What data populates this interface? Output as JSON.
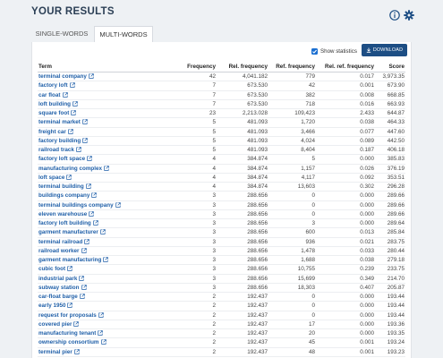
{
  "header": {
    "title": "YOUR RESULTS",
    "info_icon": "info-icon",
    "settings_icon": "gear-icon"
  },
  "tabs": [
    {
      "label": "SINGLE-WORDS",
      "active": false
    },
    {
      "label": "MULTI-WORDS",
      "active": true
    }
  ],
  "toolbar": {
    "show_statistics_label": "Show statistics",
    "show_statistics_checked": true,
    "download_label": "DOWNLOAD"
  },
  "colors": {
    "accent": "#1d4e84",
    "link": "#1f5fa8",
    "title": "#2b3f55"
  },
  "table": {
    "columns": [
      "Term",
      "Frequency",
      "Rel. frequency",
      "Ref. frequency",
      "Rel. ref. frequency",
      "Score"
    ],
    "rows": [
      [
        "terminal company",
        "42",
        "4,041.182",
        "779",
        "0.017",
        "3,973.35"
      ],
      [
        "factory loft",
        "7",
        "673.530",
        "42",
        "0.001",
        "673.90"
      ],
      [
        "car float",
        "7",
        "673.530",
        "382",
        "0.008",
        "668.85"
      ],
      [
        "loft building",
        "7",
        "673.530",
        "718",
        "0.016",
        "663.93"
      ],
      [
        "square foot",
        "23",
        "2,213.028",
        "109,423",
        "2.433",
        "644.87"
      ],
      [
        "terminal market",
        "5",
        "481.093",
        "1,720",
        "0.038",
        "464.33"
      ],
      [
        "freight car",
        "5",
        "481.093",
        "3,466",
        "0.077",
        "447.60"
      ],
      [
        "factory building",
        "5",
        "481.093",
        "4,024",
        "0.089",
        "442.50"
      ],
      [
        "railroad track",
        "5",
        "481.093",
        "8,404",
        "0.187",
        "406.18"
      ],
      [
        "factory loft space",
        "4",
        "384.874",
        "5",
        "0.000",
        "385.83"
      ],
      [
        "manufacturing complex",
        "4",
        "384.874",
        "1,157",
        "0.026",
        "376.19"
      ],
      [
        "loft space",
        "4",
        "384.874",
        "4,117",
        "0.092",
        "353.51"
      ],
      [
        "terminal building",
        "4",
        "384.874",
        "13,603",
        "0.302",
        "296.28"
      ],
      [
        "buildings company",
        "3",
        "288.656",
        "0",
        "0.000",
        "289.66"
      ],
      [
        "terminal buildings company",
        "3",
        "288.656",
        "0",
        "0.000",
        "289.66"
      ],
      [
        "eleven warehouse",
        "3",
        "288.656",
        "0",
        "0.000",
        "289.66"
      ],
      [
        "factory loft building",
        "3",
        "288.656",
        "3",
        "0.000",
        "289.64"
      ],
      [
        "garment manufacturer",
        "3",
        "288.656",
        "600",
        "0.013",
        "285.84"
      ],
      [
        "terminal railroad",
        "3",
        "288.656",
        "936",
        "0.021",
        "283.75"
      ],
      [
        "railroad worker",
        "3",
        "288.656",
        "1,478",
        "0.033",
        "280.44"
      ],
      [
        "garment manufacturing",
        "3",
        "288.656",
        "1,688",
        "0.038",
        "279.18"
      ],
      [
        "cubic foot",
        "3",
        "288.656",
        "10,755",
        "0.239",
        "233.75"
      ],
      [
        "industrial park",
        "3",
        "288.656",
        "15,699",
        "0.349",
        "214.70"
      ],
      [
        "subway station",
        "3",
        "288.656",
        "18,303",
        "0.407",
        "205.87"
      ],
      [
        "car-float barge",
        "2",
        "192.437",
        "0",
        "0.000",
        "193.44"
      ],
      [
        "early 1950",
        "2",
        "192.437",
        "0",
        "0.000",
        "193.44"
      ],
      [
        "request for proposals",
        "2",
        "192.437",
        "0",
        "0.000",
        "193.44"
      ],
      [
        "covered pier",
        "2",
        "192.437",
        "17",
        "0.000",
        "193.36"
      ],
      [
        "manufacturing tenant",
        "2",
        "192.437",
        "20",
        "0.000",
        "193.35"
      ],
      [
        "ownership consortium",
        "2",
        "192.437",
        "45",
        "0.001",
        "193.24"
      ],
      [
        "terminal pier",
        "2",
        "192.437",
        "48",
        "0.001",
        "193.23"
      ]
    ]
  }
}
